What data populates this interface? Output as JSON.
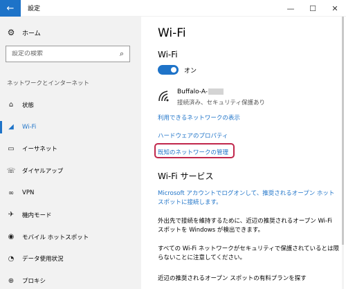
{
  "window": {
    "title": "設定",
    "back_icon": "←",
    "minimize_icon": "—",
    "maximize_icon": "☐",
    "close_icon": "✕"
  },
  "sidebar": {
    "home": {
      "label": "ホーム",
      "icon": "⚙"
    },
    "search": {
      "placeholder": "設定の検索",
      "icon": "⌕"
    },
    "section_title": "ネットワークとインターネット",
    "items": [
      {
        "label": "状態",
        "icon": "⌂"
      },
      {
        "label": "Wi-Fi",
        "icon": "◢"
      },
      {
        "label": "イーサネット",
        "icon": "▭"
      },
      {
        "label": "ダイヤルアップ",
        "icon": "☏"
      },
      {
        "label": "VPN",
        "icon": "∞"
      },
      {
        "label": "機内モード",
        "icon": "✈"
      },
      {
        "label": "モバイル ホットスポット",
        "icon": "◉"
      },
      {
        "label": "データ使用状況",
        "icon": "◔"
      },
      {
        "label": "プロキシ",
        "icon": "⊕"
      }
    ],
    "active_index": 1
  },
  "main": {
    "page_title": "Wi-Fi",
    "wifi_heading": "Wi-Fi",
    "toggle_state": "オン",
    "network": {
      "ssid": "Buffalo-A-",
      "status": "接続済み、セキュリティ保護あり"
    },
    "links": {
      "available": "利用できるネットワークの表示",
      "hardware": "ハードウェアのプロパティ",
      "known": "既知のネットワークの管理"
    },
    "services_heading": "Wi-Fi サービス",
    "services_link": "Microsoft アカウントでログオンして、推奨されるオープン ホットスポットに接続します。",
    "text1": "外出先で接続を維持するために、近辺の推奨されるオープン Wi-Fi スポットを Windows が検出できます。",
    "text2": "すべての Wi-Fi ネットワークがセキュリティで保護されているとは限らないことに注意してください。",
    "text3": "近辺の推奨されるオープン スポットの有料プランを探す"
  },
  "colors": {
    "accent": "#1e73c8",
    "highlight_box": "#c0264b",
    "sidebar_bg": "#f2f2f2"
  }
}
